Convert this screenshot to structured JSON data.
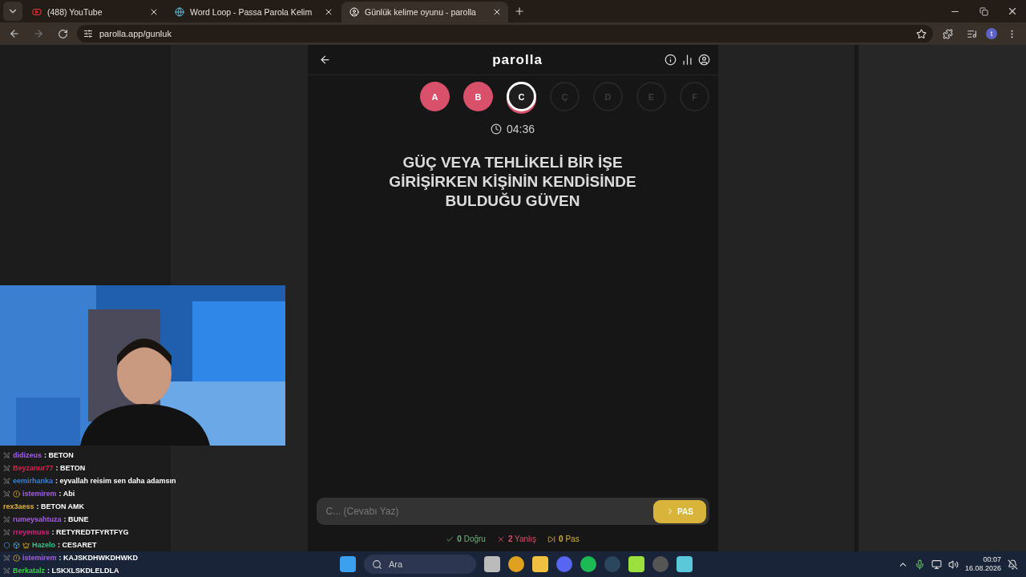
{
  "browser": {
    "tabs": [
      {
        "title": "(488) YouTube",
        "selected": false
      },
      {
        "title": "Word Loop - Passa Parola Kelim",
        "selected": false
      },
      {
        "title": "Günlük kelime oyunu - parolla",
        "selected": true
      }
    ],
    "url": "parolla.app/gunluk",
    "avatar": "t"
  },
  "game": {
    "logo": "parolla",
    "letters": [
      {
        "letter": "A",
        "kind": "wrong"
      },
      {
        "letter": "B",
        "kind": "wrong"
      },
      {
        "letter": "C",
        "kind": "current"
      },
      {
        "letter": "Ç",
        "kind": "pending"
      },
      {
        "letter": "D",
        "kind": "pending"
      },
      {
        "letter": "E",
        "kind": "pending"
      },
      {
        "letter": "F",
        "kind": "pending"
      }
    ],
    "timer": "04:36",
    "question": "GÜÇ VEYA TEHLİKELİ BİR İŞE GİRİŞİRKEN KİŞİNİN KENDİSİNDE BULDUĞU GÜVEN",
    "answer": {
      "placeholder": "C... (Cevabı Yaz)"
    },
    "pass_button": "PAS",
    "stats": [
      {
        "kind": "correct",
        "text": "**0** Doğru"
      },
      {
        "kind": "wrong",
        "text": "**2** Yanlış"
      },
      {
        "kind": "pass",
        "text": "**0** Pas"
      }
    ]
  },
  "chat": [
    {
      "user": "didizeus",
      "color": "#a45ee5",
      "message": ": BETON",
      "badges": [
        {
          "kind": "sword"
        }
      ]
    },
    {
      "user": "Beyzanur77",
      "color": "#d62450",
      "message": ": BETON",
      "badges": [
        {
          "kind": "sword"
        }
      ]
    },
    {
      "user": "eemirhanka",
      "color": "#3c7fd6",
      "message": ": eyvallah reisim sen daha adamsın",
      "badges": [
        {
          "kind": "sword"
        }
      ]
    },
    {
      "user": "istemirem",
      "color": "#a45ee5",
      "message": ": Abi",
      "badges": [
        {
          "kind": "sword"
        },
        {
          "kind": "coin"
        }
      ]
    },
    {
      "user": "rex3aess",
      "color": "#e0b040",
      "message": ": BETON AMK"
    },
    {
      "user": "rumeysahtuza",
      "color": "#a45ee5",
      "message": ": BUNE",
      "badges": [
        {
          "kind": "sword"
        }
      ]
    },
    {
      "user": "rreyemuss",
      "color": "#d62480",
      "message": ": RETYREDTFYRTFYG",
      "badges": [
        {
          "kind": "sword"
        }
      ]
    },
    {
      "user": "Hazelo",
      "color": "#2ec48a",
      "message": ": CESARET",
      "badges": [
        {
          "kind": "shield"
        },
        {
          "kind": "cube"
        },
        {
          "kind": "crown"
        }
      ]
    },
    {
      "user": "istemirem",
      "color": "#a45ee5",
      "message": ": KAJSKDHWKDHWKD",
      "badges": [
        {
          "kind": "sword"
        },
        {
          "kind": "coin"
        }
      ]
    },
    {
      "user": "Berkatalz",
      "color": "#3ccf4a",
      "message": ": LSKXLSKDLELDLA",
      "badges": [
        {
          "kind": "sword"
        }
      ]
    }
  ],
  "taskbar": {
    "search": {
      "placeholder": "Ara"
    },
    "time": "00:07",
    "date": "16.08.2026"
  }
}
